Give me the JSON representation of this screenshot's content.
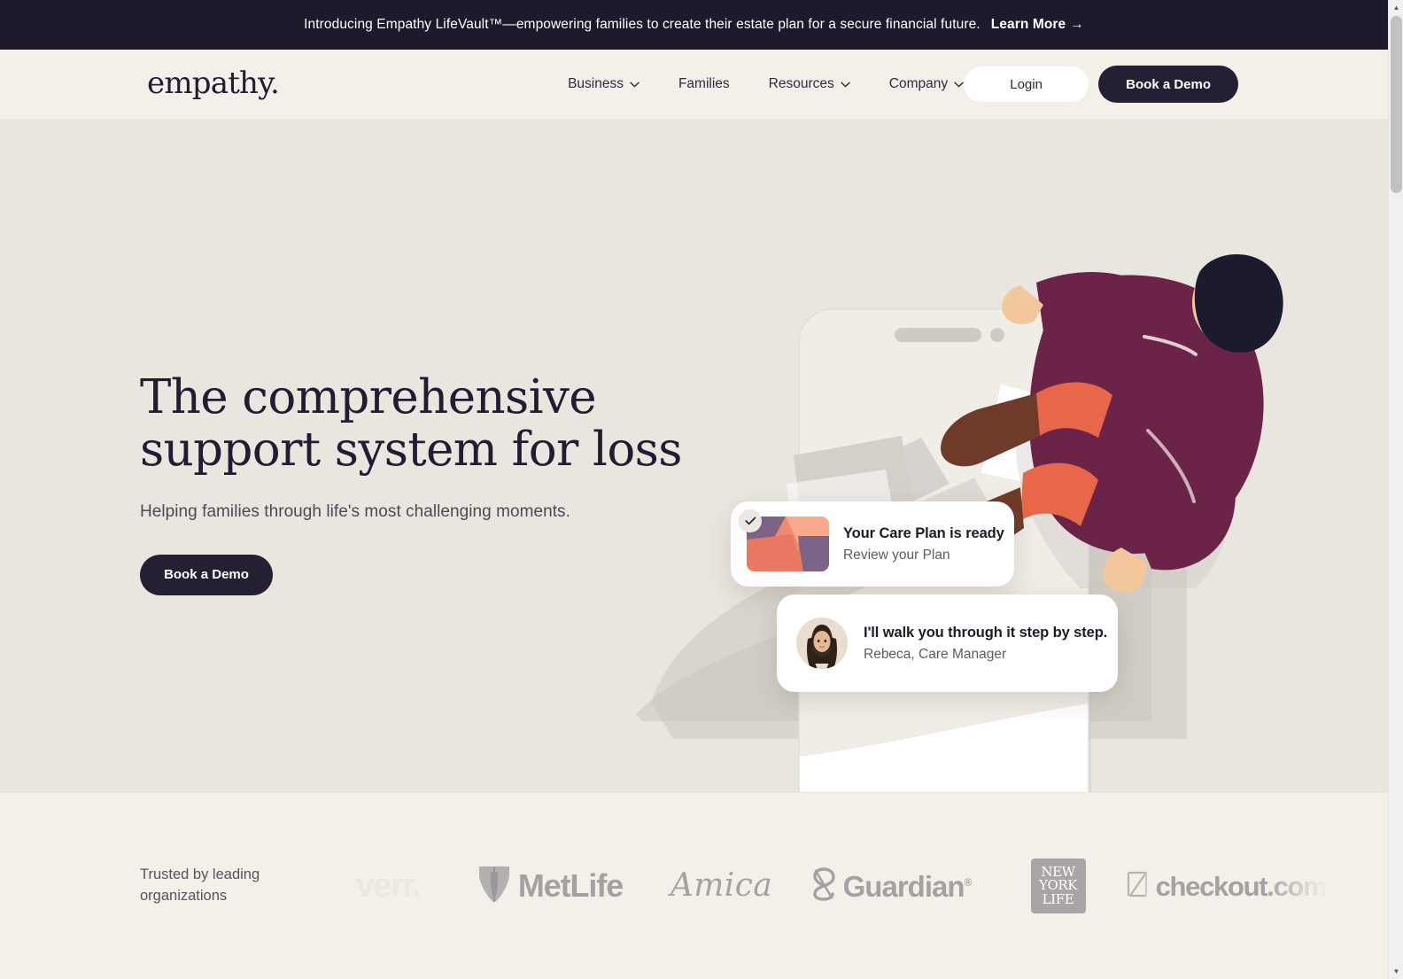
{
  "announcement": {
    "text": "Introducing Empathy LifeVault™—empowering families to create their estate plan for a secure financial future.",
    "link_label": "Learn More",
    "arrow": "→",
    "background": "#1e1a2b"
  },
  "header": {
    "logo": "empathy.",
    "nav": [
      {
        "label": "Business",
        "has_chevron": true
      },
      {
        "label": "Families",
        "has_chevron": false
      },
      {
        "label": "Resources",
        "has_chevron": true
      },
      {
        "label": "Company",
        "has_chevron": true
      }
    ],
    "login_label": "Login",
    "demo_label": "Book a Demo",
    "background": "#f3efe9"
  },
  "hero": {
    "title_line1": "The comprehensive",
    "title_line2": "support system for loss",
    "subtitle": "Helping families through life's most challenging moments.",
    "cta_label": "Book a Demo",
    "background": "#e9e5df",
    "cards": [
      {
        "id": "care-plan",
        "title": "Your Care Plan is ready",
        "subtitle": "Review your Plan",
        "badge_icon": "check-icon"
      },
      {
        "id": "care-manager",
        "title": "I'll walk you through it step by step.",
        "subtitle": "Rebeca, Care Manager",
        "avatar_name": "Rebeca"
      }
    ],
    "illustration": {
      "colors": {
        "plum": "#6b2348",
        "orange": "#e8674a",
        "boot": "#6e3b2a",
        "hair": "#1b1b2d",
        "skin": "#f2c79c",
        "phone": "#f0ece6",
        "shadow": "#cfcac4",
        "paper": "#ffffff"
      }
    }
  },
  "logos_section": {
    "trusted_line1": "Trusted by leading",
    "trusted_line2": "organizations",
    "background": "#f3efe9",
    "logos": [
      {
        "name": "verr",
        "text": "verr."
      },
      {
        "name": "metlife",
        "text": "MetLife"
      },
      {
        "name": "amica",
        "text": "Amica"
      },
      {
        "name": "guardian",
        "text": "Guardian",
        "mark": "®"
      },
      {
        "name": "new-york-life",
        "l1": "NEW",
        "l2": "YORK",
        "l3": "LIFE"
      },
      {
        "name": "checkout-com",
        "text_solid": "checkout",
        "text_fade": ".com"
      }
    ]
  },
  "scrollbar": {
    "up": "▲",
    "down": "▼"
  },
  "theme": {
    "ink": "#221c33",
    "cream": "#f3efe9",
    "hero_bg": "#e9e5df",
    "dark": "#241f33"
  }
}
